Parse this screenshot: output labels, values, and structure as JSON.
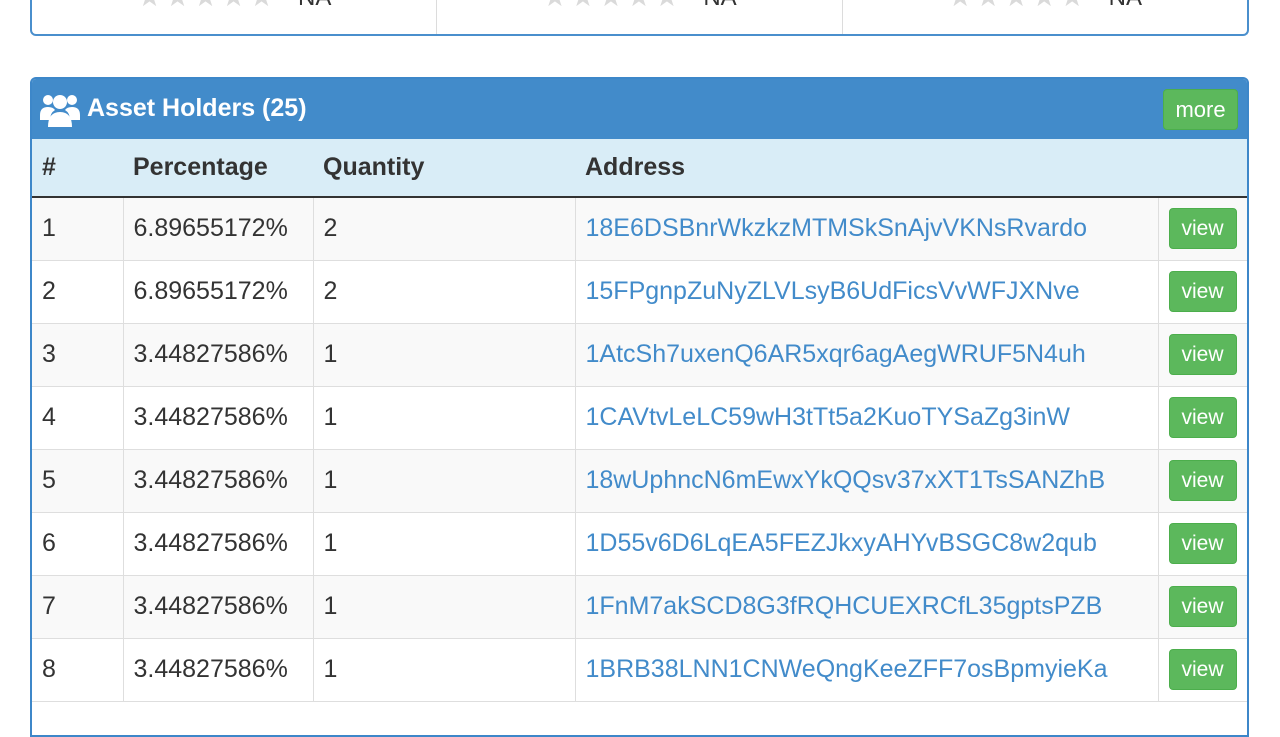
{
  "ratings": [
    {
      "value": "NA"
    },
    {
      "value": "NA"
    },
    {
      "value": "NA"
    }
  ],
  "holders": {
    "title": "Asset Holders (25)",
    "more_label": "more",
    "columns": [
      "#",
      "Percentage",
      "Quantity",
      "Address",
      ""
    ],
    "view_label": "view",
    "rows": [
      {
        "num": "1",
        "pct": "6.89655172%",
        "qty": "2",
        "addr": "18E6DSBnrWkzkzMTMSkSnAjvVKNsRvardo"
      },
      {
        "num": "2",
        "pct": "6.89655172%",
        "qty": "2",
        "addr": "15FPgnpZuNyZLVLsyB6UdFicsVvWFJXNve"
      },
      {
        "num": "3",
        "pct": "3.44827586%",
        "qty": "1",
        "addr": "1AtcSh7uxenQ6AR5xqr6agAegWRUF5N4uh"
      },
      {
        "num": "4",
        "pct": "3.44827586%",
        "qty": "1",
        "addr": "1CAVtvLeLC59wH3tTt5a2KuoTYSaZg3inW"
      },
      {
        "num": "5",
        "pct": "3.44827586%",
        "qty": "1",
        "addr": "18wUphncN6mEwxYkQQsv37xXT1TsSANZhB"
      },
      {
        "num": "6",
        "pct": "3.44827586%",
        "qty": "1",
        "addr": "1D55v6D6LqEA5FEZJkxyAHYvBSGC8w2qub"
      },
      {
        "num": "7",
        "pct": "3.44827586%",
        "qty": "1",
        "addr": "1FnM7akSCD8G3fRQHCUEXRCfL35gptsPZB"
      },
      {
        "num": "8",
        "pct": "3.44827586%",
        "qty": "1",
        "addr": "1BRB38LNN1CNWeQngKeeZFF7osBpmyieKa"
      }
    ]
  },
  "colors": {
    "heading_bg": "#428bca",
    "button_green": "#5cb85c",
    "link_blue": "#428bca",
    "header_row_bg": "#d9edf7"
  }
}
